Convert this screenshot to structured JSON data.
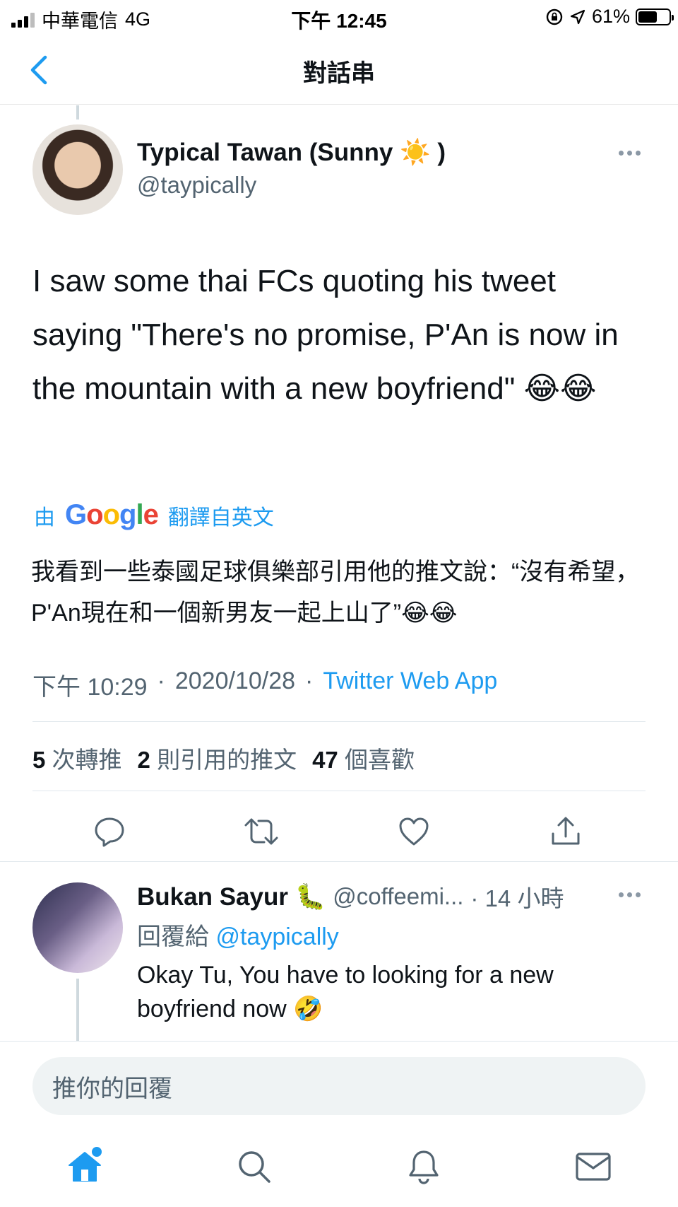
{
  "status_bar": {
    "carrier": "中華電信",
    "network": "4G",
    "time": "下午 12:45",
    "battery_text": "61%",
    "battery_level": 0.61
  },
  "header": {
    "title": "對話串",
    "back_icon": "chevron-left-icon"
  },
  "main_tweet": {
    "author_name": "Typical Tawan (Sunny ☀️ )",
    "author_handle": "@taypically",
    "text": "I saw some thai FCs quoting his tweet saying \"There's no promise, P'An is now in the mountain with a new boyfriend\" 😂😂",
    "translate_prefix": "由",
    "translate_brand": "Google",
    "translate_suffix": "翻譯自英文",
    "translated_text": "我看到一些泰國足球俱樂部引用他的推文說：“沒有希望，P'An現在和一個新男友一起上山了”😂😂",
    "time": "下午 10:29",
    "date": "2020/10/28",
    "source": "Twitter Web App",
    "separator": "·",
    "stats": {
      "retweets_count": "5",
      "retweets_label": "次轉推",
      "quotes_count": "2",
      "quotes_label": "則引用的推文",
      "likes_count": "47",
      "likes_label": "個喜歡"
    }
  },
  "reply_tweet": {
    "author_name": "Bukan Sayur 🐛",
    "author_handle": "@coffeemi...",
    "time_ago": "· 14 小時",
    "replying_to_label": "回覆給",
    "replying_to_handle": "@taypically",
    "text": "Okay Tu, You have to looking for a new boyfriend now 🤣"
  },
  "composer": {
    "placeholder": "推你的回覆"
  },
  "colors": {
    "accent": "#1d9bf0",
    "secondary_text": "#536471",
    "primary_text": "#0f1419"
  }
}
